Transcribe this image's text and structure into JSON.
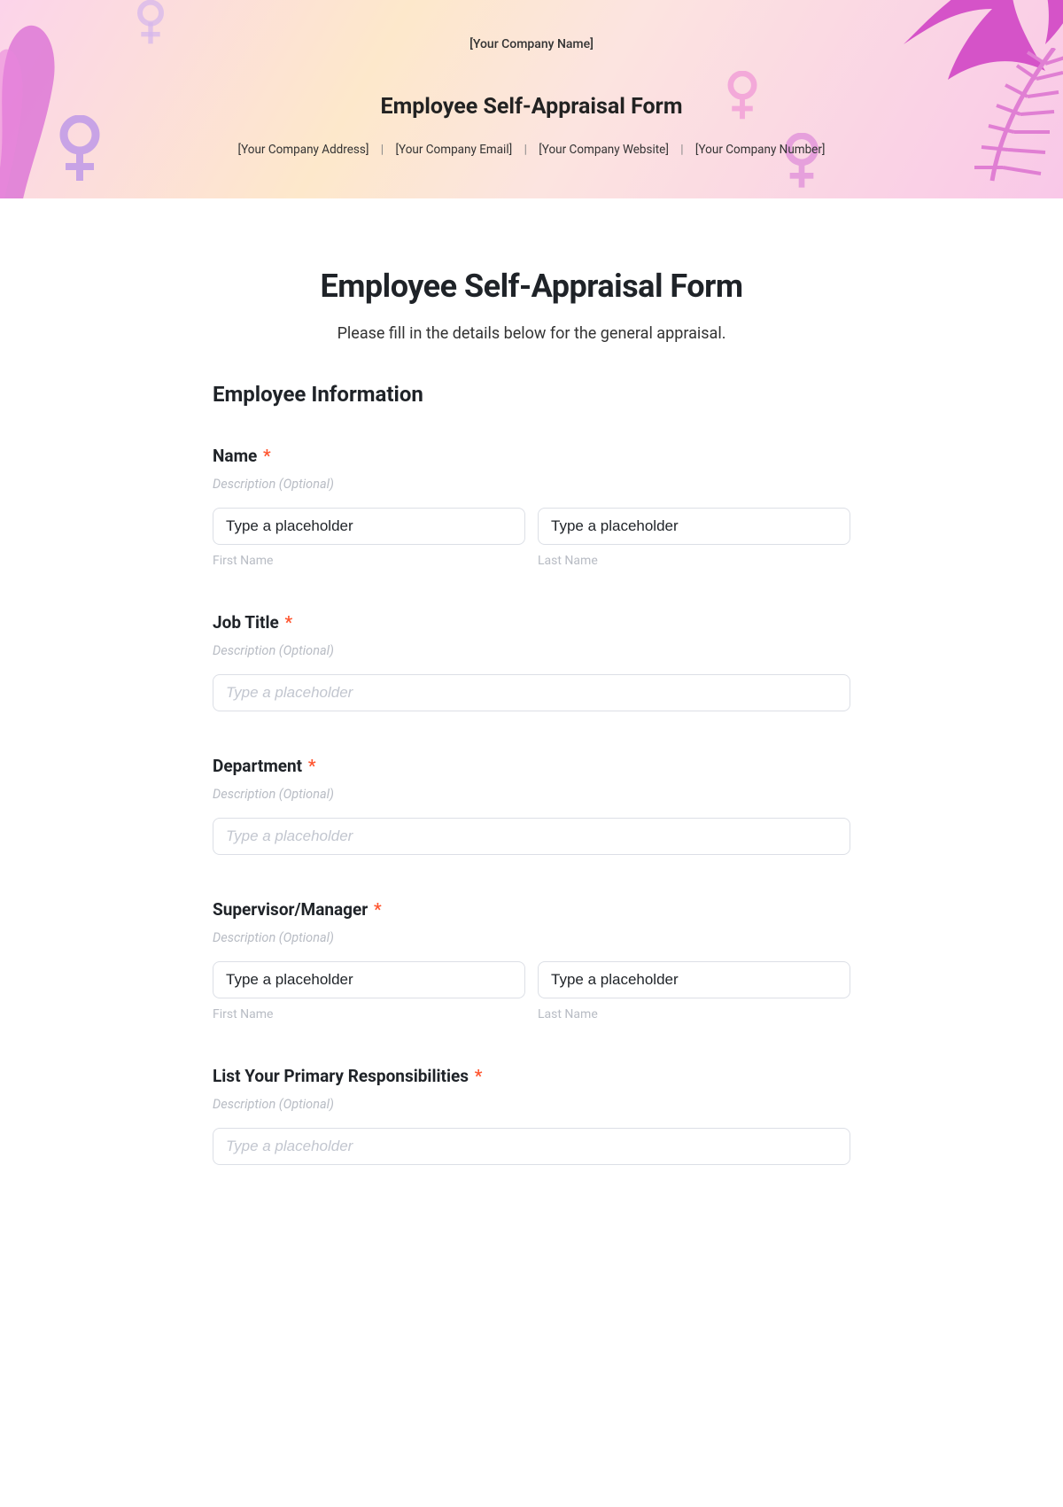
{
  "banner": {
    "company": "[Your Company Name]",
    "title": "Employee Self-Appraisal Form",
    "address": "[Your Company Address]",
    "email": "[Your Company Email]",
    "website": "[Your Company Website]",
    "number": "[Your Company Number]",
    "sep": "|"
  },
  "page": {
    "title": "Employee Self-Appraisal Form",
    "subtitle": "Please fill in the details below for the general appraisal."
  },
  "section": {
    "heading": "Employee Information"
  },
  "common": {
    "description_placeholder": "Description (Optional)",
    "input_placeholder_filled": "Type a placeholder",
    "input_placeholder_empty": "Type a placeholder",
    "first_name": "First Name",
    "last_name": "Last Name",
    "required": "*"
  },
  "fields": {
    "name": {
      "label": "Name"
    },
    "job_title": {
      "label": "Job Title"
    },
    "department": {
      "label": "Department"
    },
    "supervisor": {
      "label": "Supervisor/Manager"
    },
    "responsibilities": {
      "label": "List Your Primary Responsibilities"
    }
  }
}
